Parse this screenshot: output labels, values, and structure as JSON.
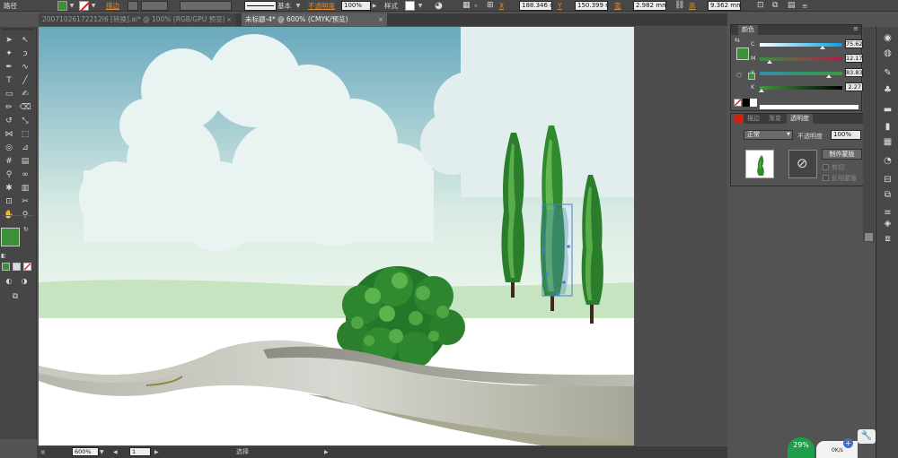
{
  "control_bar": {
    "path_label": "路径",
    "fill_color": "#3e8f3a",
    "stroke_label": "描边",
    "stroke_style_label": "基本",
    "opacity_label": "不透明度",
    "opacity_value": "100%",
    "style_label": "样式",
    "x_label": "X",
    "x_value": "188.346 mm",
    "y_label": "Y",
    "y_value": "150.399 mm",
    "w_label": "宽",
    "w_value": "2.982 mm",
    "h_label": "高",
    "h_value": "9.362 mm"
  },
  "tabs": [
    {
      "label": "20071026172212l6 [转换].ai* @ 100% (RGB/GPU 预览)",
      "close": "×"
    },
    {
      "label": "未标题-4* @ 600% (CMYK/预览)",
      "close": "×"
    }
  ],
  "toolbar": {
    "fill_color": "#3e8f3a",
    "icons": [
      "selection-icon",
      "direct-selection-icon",
      "magic-wand-icon",
      "lasso-icon",
      "pen-icon",
      "curvature-icon",
      "type-icon",
      "line-icon",
      "rectangle-icon",
      "paintbrush-icon",
      "pencil-icon",
      "eraser-icon",
      "rotate-icon",
      "scale-icon",
      "width-icon",
      "free-transform-icon",
      "shape-builder-icon",
      "perspective-icon",
      "mesh-icon",
      "gradient-icon",
      "eyedropper-icon",
      "blend-icon",
      "symbol-sprayer-icon",
      "graph-icon",
      "artboard-icon",
      "slice-icon",
      "hand-icon",
      "zoom-icon"
    ]
  },
  "status_bar": {
    "zoom": "600%",
    "page": "1",
    "tool_name": "选择"
  },
  "color_panel": {
    "title": "颜色",
    "sliders": [
      {
        "name": "C",
        "value": "75.62",
        "unit": "%",
        "level": 0.76,
        "from": "#ffffff",
        "to": "#00a0e6"
      },
      {
        "name": "M",
        "value": "12.17",
        "unit": "%",
        "level": 0.12,
        "from": "#3a8f3f",
        "to": "#b01c4a"
      },
      {
        "name": "Y",
        "value": "83.83",
        "unit": "%",
        "level": 0.84,
        "from": "#2e8fb0",
        "to": "#3a9a3a"
      },
      {
        "name": "K",
        "value": "2.27",
        "unit": "%",
        "level": 0.02,
        "from": "#3f9a3c",
        "to": "#000000"
      }
    ],
    "current_color": "#3e8f3a"
  },
  "transparency_panel": {
    "tabs": [
      "描边",
      "渐变",
      "透明度"
    ],
    "active_tab": 2,
    "blend_mode": "正常",
    "opacity_label": "不透明度",
    "opacity_value": "100%",
    "make_mask_label": "制作蒙版",
    "clip_label": "剪切",
    "invert_mask_label": "反相蒙版"
  },
  "net_widget": {
    "percent": "29%",
    "speed": "0K/s"
  },
  "colors": {
    "sky_top": "#6aa9be",
    "sky_bottom": "#eaf3ec",
    "hill": "#c3e4bd",
    "tree_dark": "#247a2a",
    "tree_light": "#5cb54a",
    "road": "#c8c8c0"
  }
}
